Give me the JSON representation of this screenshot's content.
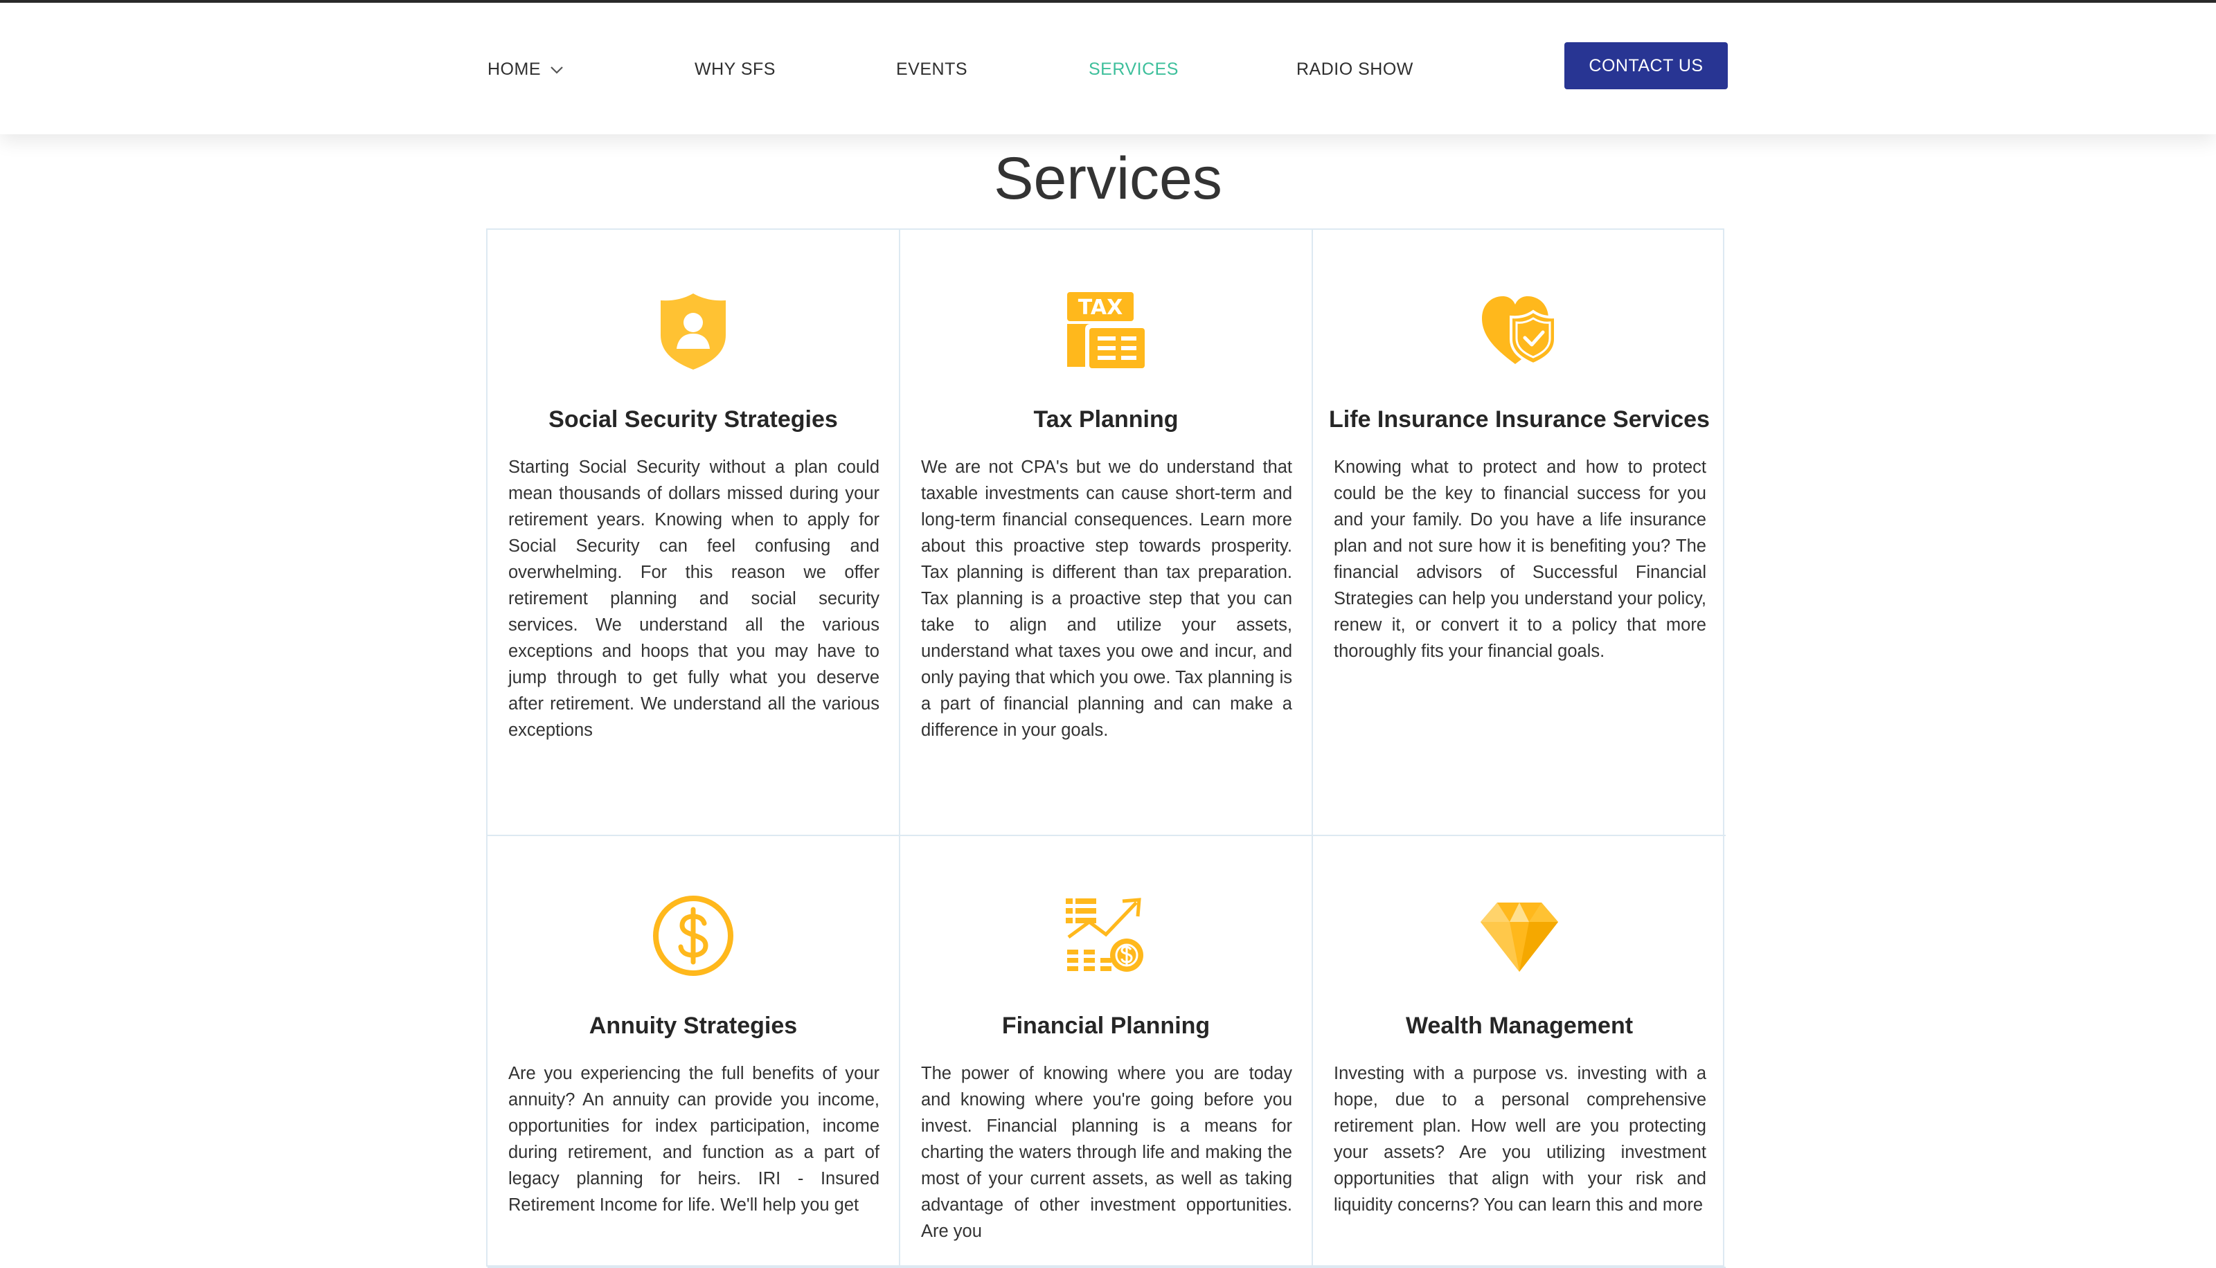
{
  "nav": {
    "items": [
      {
        "label": "HOME",
        "has_dropdown": true
      },
      {
        "label": "WHY SFS"
      },
      {
        "label": "EVENTS"
      },
      {
        "label": "SERVICES",
        "active": true
      },
      {
        "label": "RADIO SHOW"
      }
    ],
    "cta_label": "CONTACT US"
  },
  "colors": {
    "accent": "#3dbf9b",
    "brand": "#283593",
    "icon": "#ffb81c",
    "border": "#dde9f2"
  },
  "page_title": "Services",
  "services": [
    {
      "icon": "shield-person-icon",
      "title": "Social Security Strategies",
      "text": "Starting Social Security without a plan could mean thousands of dollars missed during your retirement years. Knowing when to apply for Social Security can feel confusing and overwhelming. For this reason we offer retirement planning and social security services. We understand all the various exceptions and hoops that you may have to jump through to get fully what you deserve after retirement. We understand all the various exceptions"
    },
    {
      "icon": "tax-document-icon",
      "title": "Tax Planning",
      "text": "We are not CPA's but we do understand that taxable investments can cause short-term and long-term financial consequences. Learn more about this proactive step towards prosperity. Tax planning is different than tax preparation. Tax planning is a proactive step that you can take to align and utilize your assets, understand what taxes you owe and incur, and only paying that which you owe. Tax planning is a part of financial planning and can make a difference in your goals."
    },
    {
      "icon": "heart-shield-icon",
      "title": "Life Insurance Insurance Services",
      "text": "Knowing what to protect and how to protect could be the key to financial success for you and your family. Do you have a life insurance plan and not sure how it is benefiting you? The financial advisors of Successful Financial Strategies can help you understand your policy, renew it, or convert it to a policy that more thoroughly fits your financial goals."
    },
    {
      "icon": "dollar-coin-icon",
      "title": "Annuity Strategies",
      "text": "Are you experiencing the full benefits of your annuity? An annuity can provide you income, opportunities for index participation, income during retirement, and function as a part of legacy planning for heirs. IRI - Insured Retirement Income for life. We'll help you get"
    },
    {
      "icon": "growth-chart-icon",
      "title": "Financial Planning",
      "text": "The power of knowing where you are today and knowing where you're going before you invest. Financial planning is a means for charting the waters through life and making the most of your current assets, as well as taking advantage of other investment opportunities. Are you"
    },
    {
      "icon": "diamond-icon",
      "title": "Wealth Management",
      "text": "Investing with a purpose vs. investing with a hope, due to a personal comprehensive retirement plan. How well are you protecting your assets? Are you utilizing investment opportunities that align with your risk and liquidity concerns? You can learn this and more"
    }
  ]
}
